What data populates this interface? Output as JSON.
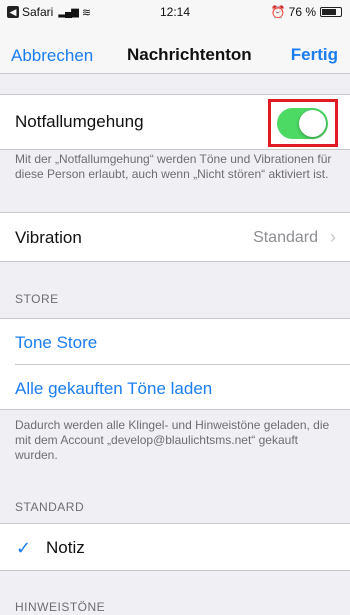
{
  "status_bar": {
    "back_app": "Safari",
    "time": "12:14",
    "battery_percent": "76 %",
    "battery_level": 0.76,
    "icons": [
      "back-badge-icon",
      "signal-icon",
      "wifi-icon",
      "alarm-icon",
      "battery-icon"
    ]
  },
  "nav": {
    "cancel_label": "Abbrechen",
    "title": "Nachrichtenton",
    "done_label": "Fertig"
  },
  "emergency_bypass": {
    "label": "Notfallumgehung",
    "enabled": true,
    "footer": "Mit der „Notfallumgehung“ werden Töne und Vibrationen für diese Person erlaubt, auch wenn „Nicht stören“ aktiviert ist."
  },
  "vibration": {
    "label": "Vibration",
    "value": "Standard"
  },
  "store": {
    "header": "STORE",
    "tone_store_label": "Tone Store",
    "download_all_label": "Alle gekauften Töne laden",
    "footer": "Dadurch werden alle Klingel- und Hinweistöne geladen, die mit dem Account „develop@blaulichtsms.net“ gekauft wurden."
  },
  "standard": {
    "header": "STANDARD",
    "selected_tone": "Notiz"
  },
  "alert_tones": {
    "header": "HINWEISTÖNE"
  },
  "colors": {
    "accent": "#1a7df0",
    "toggle_on": "#4cd964",
    "highlight": "#e01b24"
  }
}
